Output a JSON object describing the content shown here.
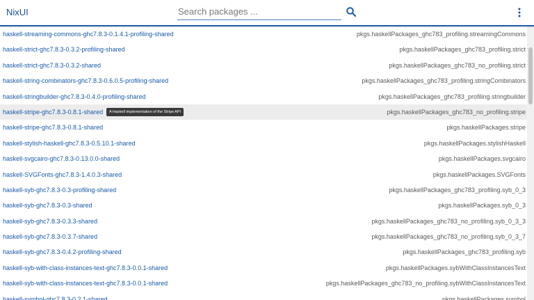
{
  "header": {
    "title": "NixUI",
    "search_placeholder": "Search packages ...",
    "search_icon": "search-icon",
    "menu_icon": "more-vertical-icon"
  },
  "colors": {
    "accent": "#1f5fa8",
    "link": "#1a5aa8",
    "attr_text": "#5a5a5a",
    "hover_row": "#ececec",
    "tooltip_bg": "#3a3a3a"
  },
  "packages": [
    {
      "name": "haskell-streaming-commons-ghc7.8.3-0.1.4.1-profiling-shared",
      "attr": "pkgs.haskellPackages_ghc783_profiling.streamingCommons"
    },
    {
      "name": "haskell-strict-ghc7.8.3-0.3.2-profiling-shared",
      "attr": "pkgs.haskellPackages_ghc783_profiling.strict"
    },
    {
      "name": "haskell-strict-ghc7.8.3-0.3.2-shared",
      "attr": "pkgs.haskellPackages_ghc783_no_profiling.strict"
    },
    {
      "name": "haskell-string-combinators-ghc7.8.3-0.6.0.5-profiling-shared",
      "attr": "pkgs.haskellPackages_ghc783_profiling.stringCombinators"
    },
    {
      "name": "haskell-stringbuilder-ghc7.8.3-0.4.0-profiling-shared",
      "attr": "pkgs.haskellPackages_ghc783_profiling.stringbuilder"
    },
    {
      "name": "haskell-stripe-ghc7.8.3-0.8.1-shared",
      "attr": "pkgs.haskellPackages_ghc783_no_profiling.stripe",
      "tooltip": "A Haskell implementation of the Stripe API",
      "hovered": true
    },
    {
      "name": "haskell-stripe-ghc7.8.3-0.8.1-shared",
      "attr": "pkgs.haskellPackages.stripe"
    },
    {
      "name": "haskell-stylish-haskell-ghc7.8.3-0.5.10.1-shared",
      "attr": "pkgs.haskellPackages.stylishHaskell"
    },
    {
      "name": "haskell-svgcairo-ghc7.8.3-0.13.0.0-shared",
      "attr": "pkgs.haskellPackages.svgcairo"
    },
    {
      "name": "haskell-SVGFonts-ghc7.8.3-1.4.0.3-shared",
      "attr": "pkgs.haskellPackages.SVGFonts"
    },
    {
      "name": "haskell-syb-ghc7.8.3-0.3-profiling-shared",
      "attr": "pkgs.haskellPackages_ghc783_profiling.syb_0_3"
    },
    {
      "name": "haskell-syb-ghc7.8.3-0.3-shared",
      "attr": "pkgs.haskellPackages.syb_0_3"
    },
    {
      "name": "haskell-syb-ghc7.8.3-0.3.3-shared",
      "attr": "pkgs.haskellPackages_ghc783_no_profiling.syb_0_3_3"
    },
    {
      "name": "haskell-syb-ghc7.8.3-0.3.7-shared",
      "attr": "pkgs.haskellPackages_ghc783_no_profiling.syb_0_3_7"
    },
    {
      "name": "haskell-syb-ghc7.8.3-0.4.2-profiling-shared",
      "attr": "pkgs.haskellPackages_ghc783_profiling.syb"
    },
    {
      "name": "haskell-syb-with-class-instances-text-ghc7.8.3-0.0.1-shared",
      "attr": "pkgs.haskellPackages.sybWithClassInstancesText"
    },
    {
      "name": "haskell-syb-with-class-instances-text-ghc7.8.3-0.0.1-shared",
      "attr": "pkgs.haskellPackages_ghc783_no_profiling.sybWithClassInstancesText"
    },
    {
      "name": "haskell-symbol-ghc7.8.3-0.2.1-shared",
      "attr": "pkgs.haskellPackages.symbol"
    }
  ]
}
